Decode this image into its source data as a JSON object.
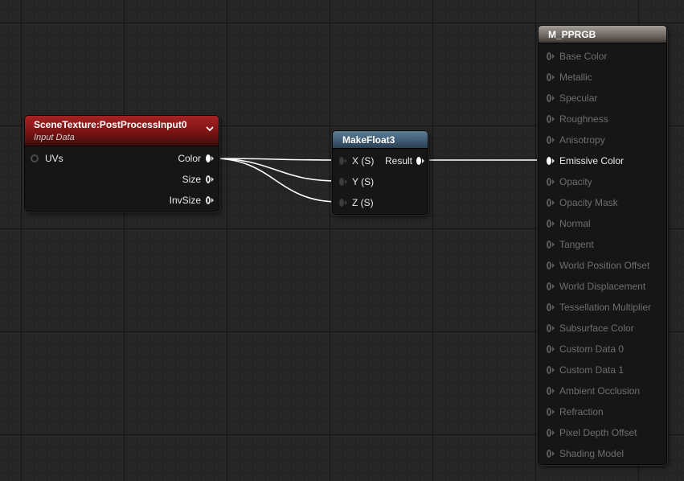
{
  "scene_texture_node": {
    "title": "SceneTexture:PostProcessInput0",
    "subtitle": "Input Data",
    "inputs": [
      "UVs"
    ],
    "outputs": [
      "Color",
      "Size",
      "InvSize"
    ],
    "header_color": "#8e1a1a"
  },
  "make_float3_node": {
    "title": "MakeFloat3",
    "inputs": [
      "X (S)",
      "Y (S)",
      "Z (S)"
    ],
    "output": "Result",
    "header_color": "#3f5c74"
  },
  "material_node": {
    "title": "M_PPRGB",
    "header_color": "#6e6660",
    "inputs": [
      {
        "label": "Base Color",
        "active": false
      },
      {
        "label": "Metallic",
        "active": false
      },
      {
        "label": "Specular",
        "active": false
      },
      {
        "label": "Roughness",
        "active": false
      },
      {
        "label": "Anisotropy",
        "active": false
      },
      {
        "label": "Emissive Color",
        "active": true
      },
      {
        "label": "Opacity",
        "active": false
      },
      {
        "label": "Opacity Mask",
        "active": false
      },
      {
        "label": "Normal",
        "active": false
      },
      {
        "label": "Tangent",
        "active": false
      },
      {
        "label": "World Position Offset",
        "active": false
      },
      {
        "label": "World Displacement",
        "active": false
      },
      {
        "label": "Tessellation Multiplier",
        "active": false
      },
      {
        "label": "Subsurface Color",
        "active": false
      },
      {
        "label": "Custom Data 0",
        "active": false
      },
      {
        "label": "Custom Data 1",
        "active": false
      },
      {
        "label": "Ambient Occlusion",
        "active": false
      },
      {
        "label": "Refraction",
        "active": false
      },
      {
        "label": "Pixel Depth Offset",
        "active": false
      },
      {
        "label": "Shading Model",
        "active": false
      }
    ]
  },
  "colors": {
    "canvas_bg": "#262626",
    "wire": "#ffffff",
    "dim_text": "#6e6e6e"
  }
}
